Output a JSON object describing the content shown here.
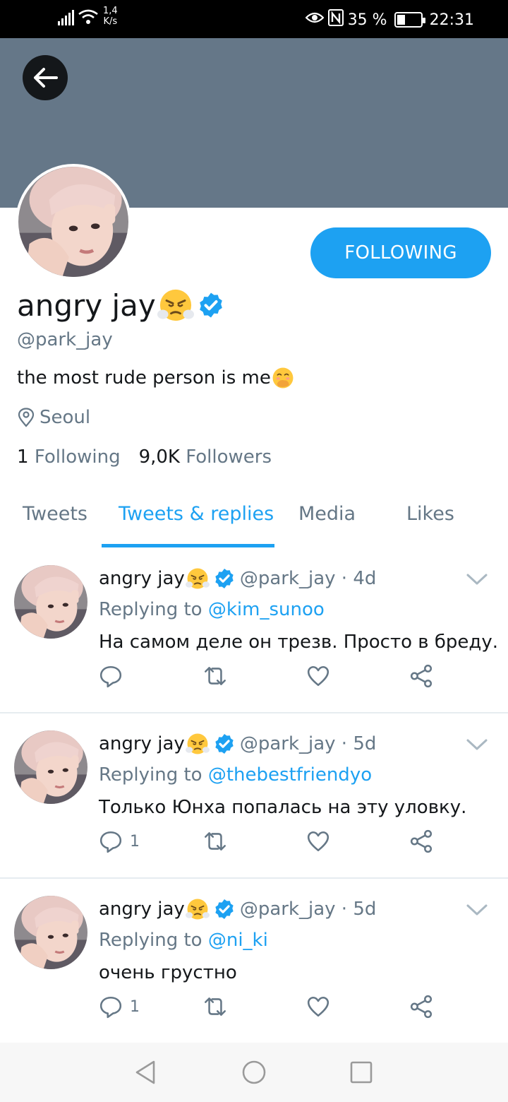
{
  "status_bar": {
    "speed_value": "1,4",
    "speed_unit": "K/s",
    "battery": "35 %",
    "battery_level": 0.35,
    "time": "22:31"
  },
  "colors": {
    "accent": "#1da1f2",
    "banner": "#657788",
    "muted": "#657786",
    "text": "#14171a"
  },
  "profile": {
    "follow_button": "FOLLOWING",
    "display_name": "angry jay",
    "handle": "@park_jay",
    "bio": "the most rude person is me",
    "location": "Seoul",
    "following_count": "1",
    "following_label": "Following",
    "followers_count": "9,0K",
    "followers_label": "Followers"
  },
  "tabs": [
    {
      "label": "Tweets",
      "active": false
    },
    {
      "label": "Tweets & replies",
      "active": true
    },
    {
      "label": "Media",
      "active": false
    },
    {
      "label": "Likes",
      "active": false
    }
  ],
  "tweets": [
    {
      "name": "angry jay",
      "meta": "@park_jay · 4d",
      "replying_prefix": "Replying to",
      "mention": "@kim_sunoo",
      "text": "На самом деле он трезв. Просто в бреду.",
      "reply_count": ""
    },
    {
      "name": "angry jay",
      "meta": "@park_jay · 5d",
      "replying_prefix": "Replying to",
      "mention": "@thebestfriendyo",
      "text": "Только Юнха попалась на эту уловку.",
      "reply_count": "1"
    },
    {
      "name": "angry jay",
      "meta": "@park_jay · 5d",
      "replying_prefix": "Replying to",
      "mention": "@ni_ki",
      "text": "очень грустно",
      "reply_count": "1"
    }
  ],
  "icons": {
    "back": "arrow-left-icon",
    "verified": "verified-badge-icon",
    "location": "location-pin-icon",
    "reply": "reply-icon",
    "retweet": "retweet-icon",
    "like": "heart-icon",
    "share": "share-icon",
    "caret": "chevron-down-icon"
  }
}
